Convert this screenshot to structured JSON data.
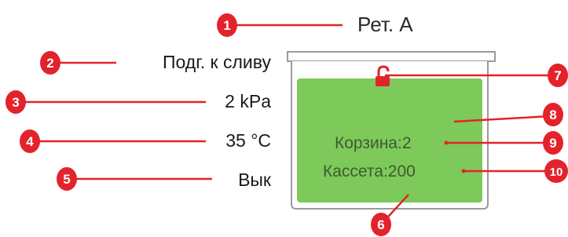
{
  "retort": {
    "name": "Рет. А",
    "status": "Подг. к сливу",
    "pressure": "2 kPa",
    "temperature": "35 °C",
    "mode": "Вык",
    "basket": "Корзина:2",
    "cassette": "Кассета:200"
  },
  "callouts": [
    "1",
    "2",
    "3",
    "4",
    "5",
    "6",
    "7",
    "8",
    "9",
    "10"
  ],
  "colors": {
    "callout_red": "#e3232c",
    "tank_green": "#7dc95a",
    "tank_outline": "#9a9a9a",
    "lock_red": "#e3232c"
  },
  "icons": [
    "unlocked-padlock-icon"
  ]
}
